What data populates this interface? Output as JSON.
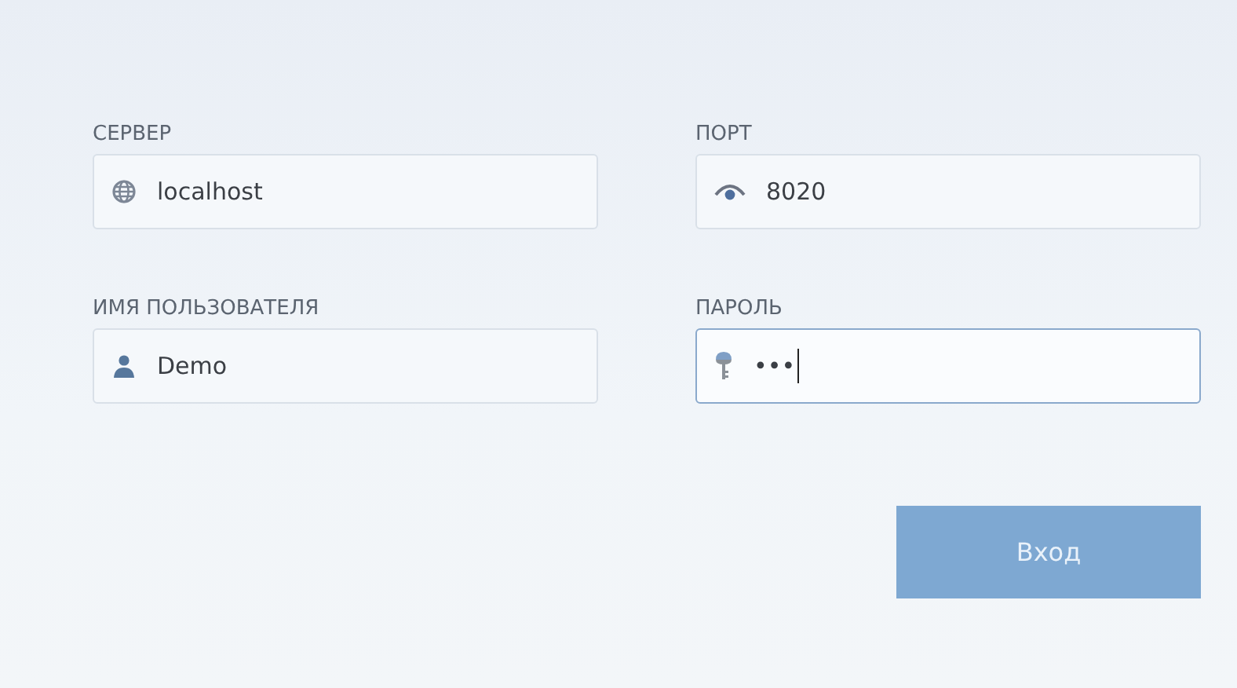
{
  "fields": [
    {
      "label": "СЕРВЕР",
      "kind": "globe",
      "value": "localhost",
      "focused": false
    },
    {
      "label": "ПОРТ",
      "kind": "eye",
      "value": "8020",
      "focused": false
    },
    {
      "label": "ИМЯ ПОЛЬЗОВАТЕЛЯ",
      "kind": "user",
      "value": "Demo",
      "focused": false
    },
    {
      "label": "ПАРОЛЬ",
      "kind": "key",
      "value": "•••",
      "focused": true
    }
  ],
  "button": {
    "label": "Вход",
    "disabled": true
  }
}
